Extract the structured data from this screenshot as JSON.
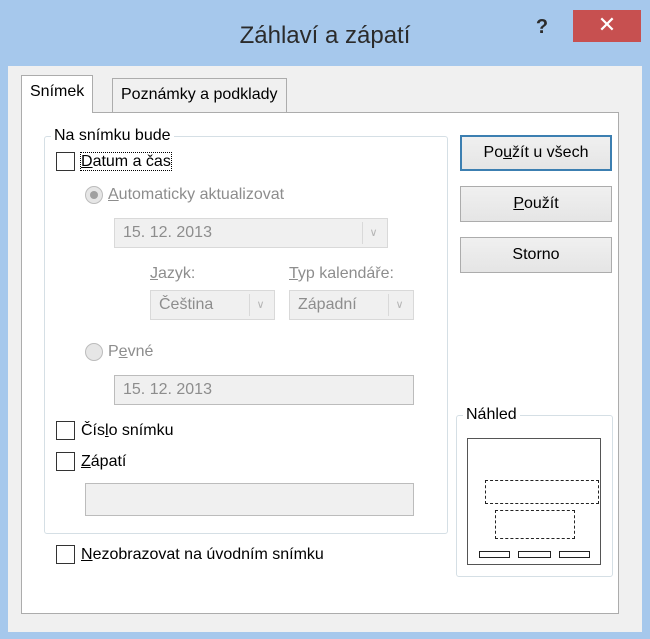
{
  "window": {
    "title": "Záhlaví a zápatí",
    "help_glyph": "?",
    "close_glyph": "✕"
  },
  "tabs": [
    {
      "label": "Snímek",
      "active": true
    },
    {
      "label": "Poznámky a podklady",
      "active": false
    }
  ],
  "slide_group": {
    "label": "Na snímku bude",
    "date_time": {
      "pre": "",
      "u": "D",
      "post": "atum a čas",
      "checked": false
    },
    "auto_update": {
      "pre": "",
      "u": "A",
      "post": "utomaticky aktualizovat",
      "selected": true
    },
    "auto_date_value": "15. 12. 2013",
    "language": {
      "pre": "",
      "u": "J",
      "post": "azyk:",
      "value": "Čeština"
    },
    "calendar": {
      "pre": "",
      "u": "T",
      "post": "yp kalendáře:",
      "value": "Západní"
    },
    "fixed": {
      "pre": "P",
      "u": "e",
      "post": "vné",
      "selected": false
    },
    "fixed_value": "15. 12. 2013",
    "slide_number": {
      "pre": "Čís",
      "u": "l",
      "post": "o snímku",
      "checked": false
    },
    "footer": {
      "pre": "",
      "u": "Z",
      "post": "ápatí",
      "checked": false,
      "value": ""
    }
  },
  "dont_show_title": {
    "pre": "",
    "u": "N",
    "post": "ezobrazovat na úvodním snímku",
    "checked": false
  },
  "buttons": {
    "apply_all": {
      "pre": "Po",
      "u": "u",
      "post": "žít u všech"
    },
    "apply": {
      "pre": "",
      "u": "P",
      "post": "oužít"
    },
    "cancel": {
      "label": "Storno"
    }
  },
  "preview": {
    "label": "Náhled"
  },
  "dropdown_glyph": "∨",
  "colors": {
    "title_bar": "#a6c8ec",
    "close_button": "#c75050",
    "default_button_border": "#3c7fb1"
  }
}
